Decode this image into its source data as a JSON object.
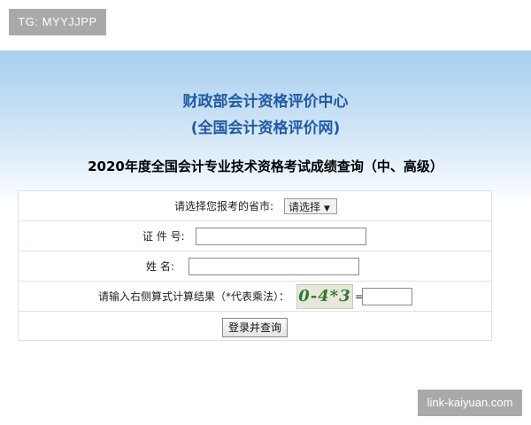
{
  "tag_badge": "TG: MYYJJPP",
  "header": {
    "org_title_line1": "财政部会计资格评价中心",
    "org_title_line2": "(全国会计资格评价网)",
    "exam_title": "2020年度全国会计专业技术资格考试成绩查询（中、高级）"
  },
  "form": {
    "province_label": "请选择您报考的省市:",
    "province_selected": "请选择",
    "id_label": "证 件 号:",
    "id_value": "",
    "name_label": "姓  名:",
    "name_value": "",
    "captcha_label": "请输入右侧算式计算结果（*代表乘法）：",
    "captcha_text": "0-4*3",
    "equals_sign": "=",
    "captcha_answer": "",
    "submit_label": "登录并查询"
  },
  "watermark": "link-kaiyuan.com",
  "icons": {
    "dropdown": "triangle-down-icon"
  },
  "colors": {
    "title_blue": "#1f5aa6",
    "header_gradient_top": "#a9cfee",
    "captcha_green": "#2f7a2f",
    "badge_gray": "#a9a9a9"
  }
}
